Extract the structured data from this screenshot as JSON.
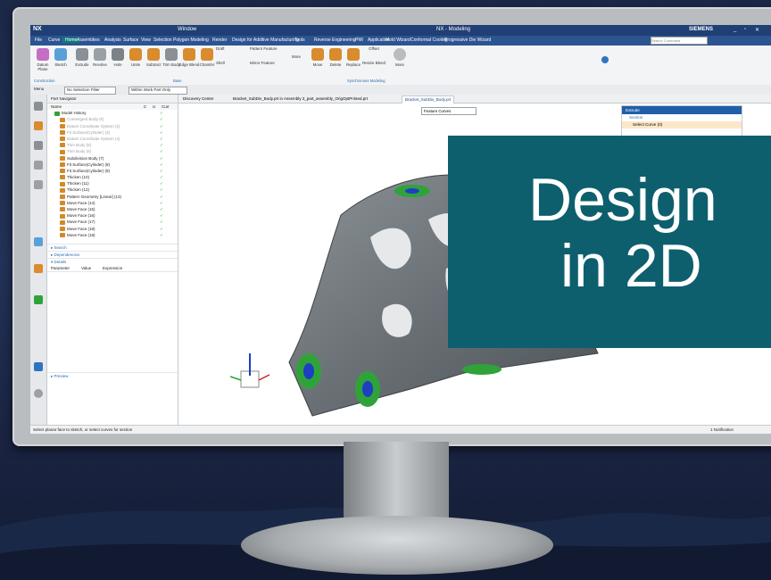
{
  "app": {
    "logo": "NX",
    "window_menu": "Window",
    "title": "NX - Modeling",
    "brand": "SIEMENS",
    "search_placeholder": "Search Command"
  },
  "menu": [
    "File",
    "Curve",
    "Home",
    "Assemblies",
    "Analysis",
    "Surface",
    "View",
    "Selection",
    "Polygon Modeling",
    "Render",
    "Design for Additive Manufacturing",
    "Tools",
    "Reverse Engineering",
    "PMI",
    "Application",
    "Mold Wizard",
    "Conformal Cooling",
    "Progressive Die Wizard"
  ],
  "menu_active": "Home",
  "ribbon": {
    "construction": [
      "Datum Plane",
      "Sketch"
    ],
    "base": [
      "Extrude",
      "Revolve",
      "Hole",
      "Unite",
      "Subtract",
      "Trim Body",
      "Edge Blend",
      "Chamfer"
    ],
    "small": [
      "Draft",
      "Shell",
      "Pattern Feature",
      "Mirror Feature",
      "More"
    ],
    "sync": [
      "Move",
      "Delete",
      "Replace",
      "Resize Blend",
      "Offset",
      "More"
    ],
    "groups": [
      "Construction",
      "Base",
      "Synchronous Modeling"
    ]
  },
  "selection_bar": {
    "menu": "Menu",
    "filter": "No Selection Filter",
    "scope": "Within Work Part Only"
  },
  "navigator": {
    "title": "Part Navigator",
    "columns": [
      "Name",
      "C",
      "U",
      "Curr"
    ],
    "root": "Model History",
    "items": [
      {
        "label": "Convergent Body (0)",
        "dim": true
      },
      {
        "label": "Datum Coordinate System (2)",
        "dim": true
      },
      {
        "label": "Fit Surface(Cylinder) (3)",
        "dim": true
      },
      {
        "label": "Datum Coordinate System (4)",
        "dim": true
      },
      {
        "label": "Trim Body (5)",
        "dim": true
      },
      {
        "label": "Trim Body (6)",
        "dim": true
      },
      {
        "label": "Subdivision Body (7)",
        "dim": false
      },
      {
        "label": "Fit Surface(Cylinder) (8)",
        "dim": false
      },
      {
        "label": "Fit Surface(Cylinder) (9)",
        "dim": false
      },
      {
        "label": "Thicken (10)",
        "dim": false
      },
      {
        "label": "Thicken (11)",
        "dim": false
      },
      {
        "label": "Thicken (12)",
        "dim": false
      },
      {
        "label": "Pattern Geometry [Linear] (13)",
        "dim": false
      },
      {
        "label": "Move Face (14)",
        "dim": false
      },
      {
        "label": "Move Face (15)",
        "dim": false
      },
      {
        "label": "Move Face (16)",
        "dim": false
      },
      {
        "label": "Move Face (17)",
        "dim": false
      },
      {
        "label": "Move Face (18)",
        "dim": false
      },
      {
        "label": "Move Face (19)",
        "dim": false
      }
    ],
    "sections": [
      "Search",
      "Dependencies",
      "Details",
      "Preview"
    ],
    "details_columns": [
      "Parameter",
      "Value",
      "Expression"
    ]
  },
  "tabs": [
    "Discovery Center",
    "Bracket_SubDiv_Body.prt in Assembly 3_part_assembly_OrigOptPrinted.prt",
    "Bracket_SubDiv_Body.prt"
  ],
  "feature_dropdown": "Feature Curves",
  "extrude_dialog": {
    "title": "Extrude",
    "section": "Section",
    "select": "Select Curve (0)"
  },
  "status": {
    "prompt": "Select planar face to sketch, or select curves for section",
    "notification": "1 Notification"
  },
  "overlay": {
    "line1": "Design",
    "line2": "in 2D"
  },
  "colors": {
    "overlay": "#0d5f6e",
    "titlebar": "#1f3f75",
    "menubar": "#2c5491",
    "model": "#6c7378",
    "ring": "#2fa33a",
    "hole": "#1d3fc2"
  }
}
